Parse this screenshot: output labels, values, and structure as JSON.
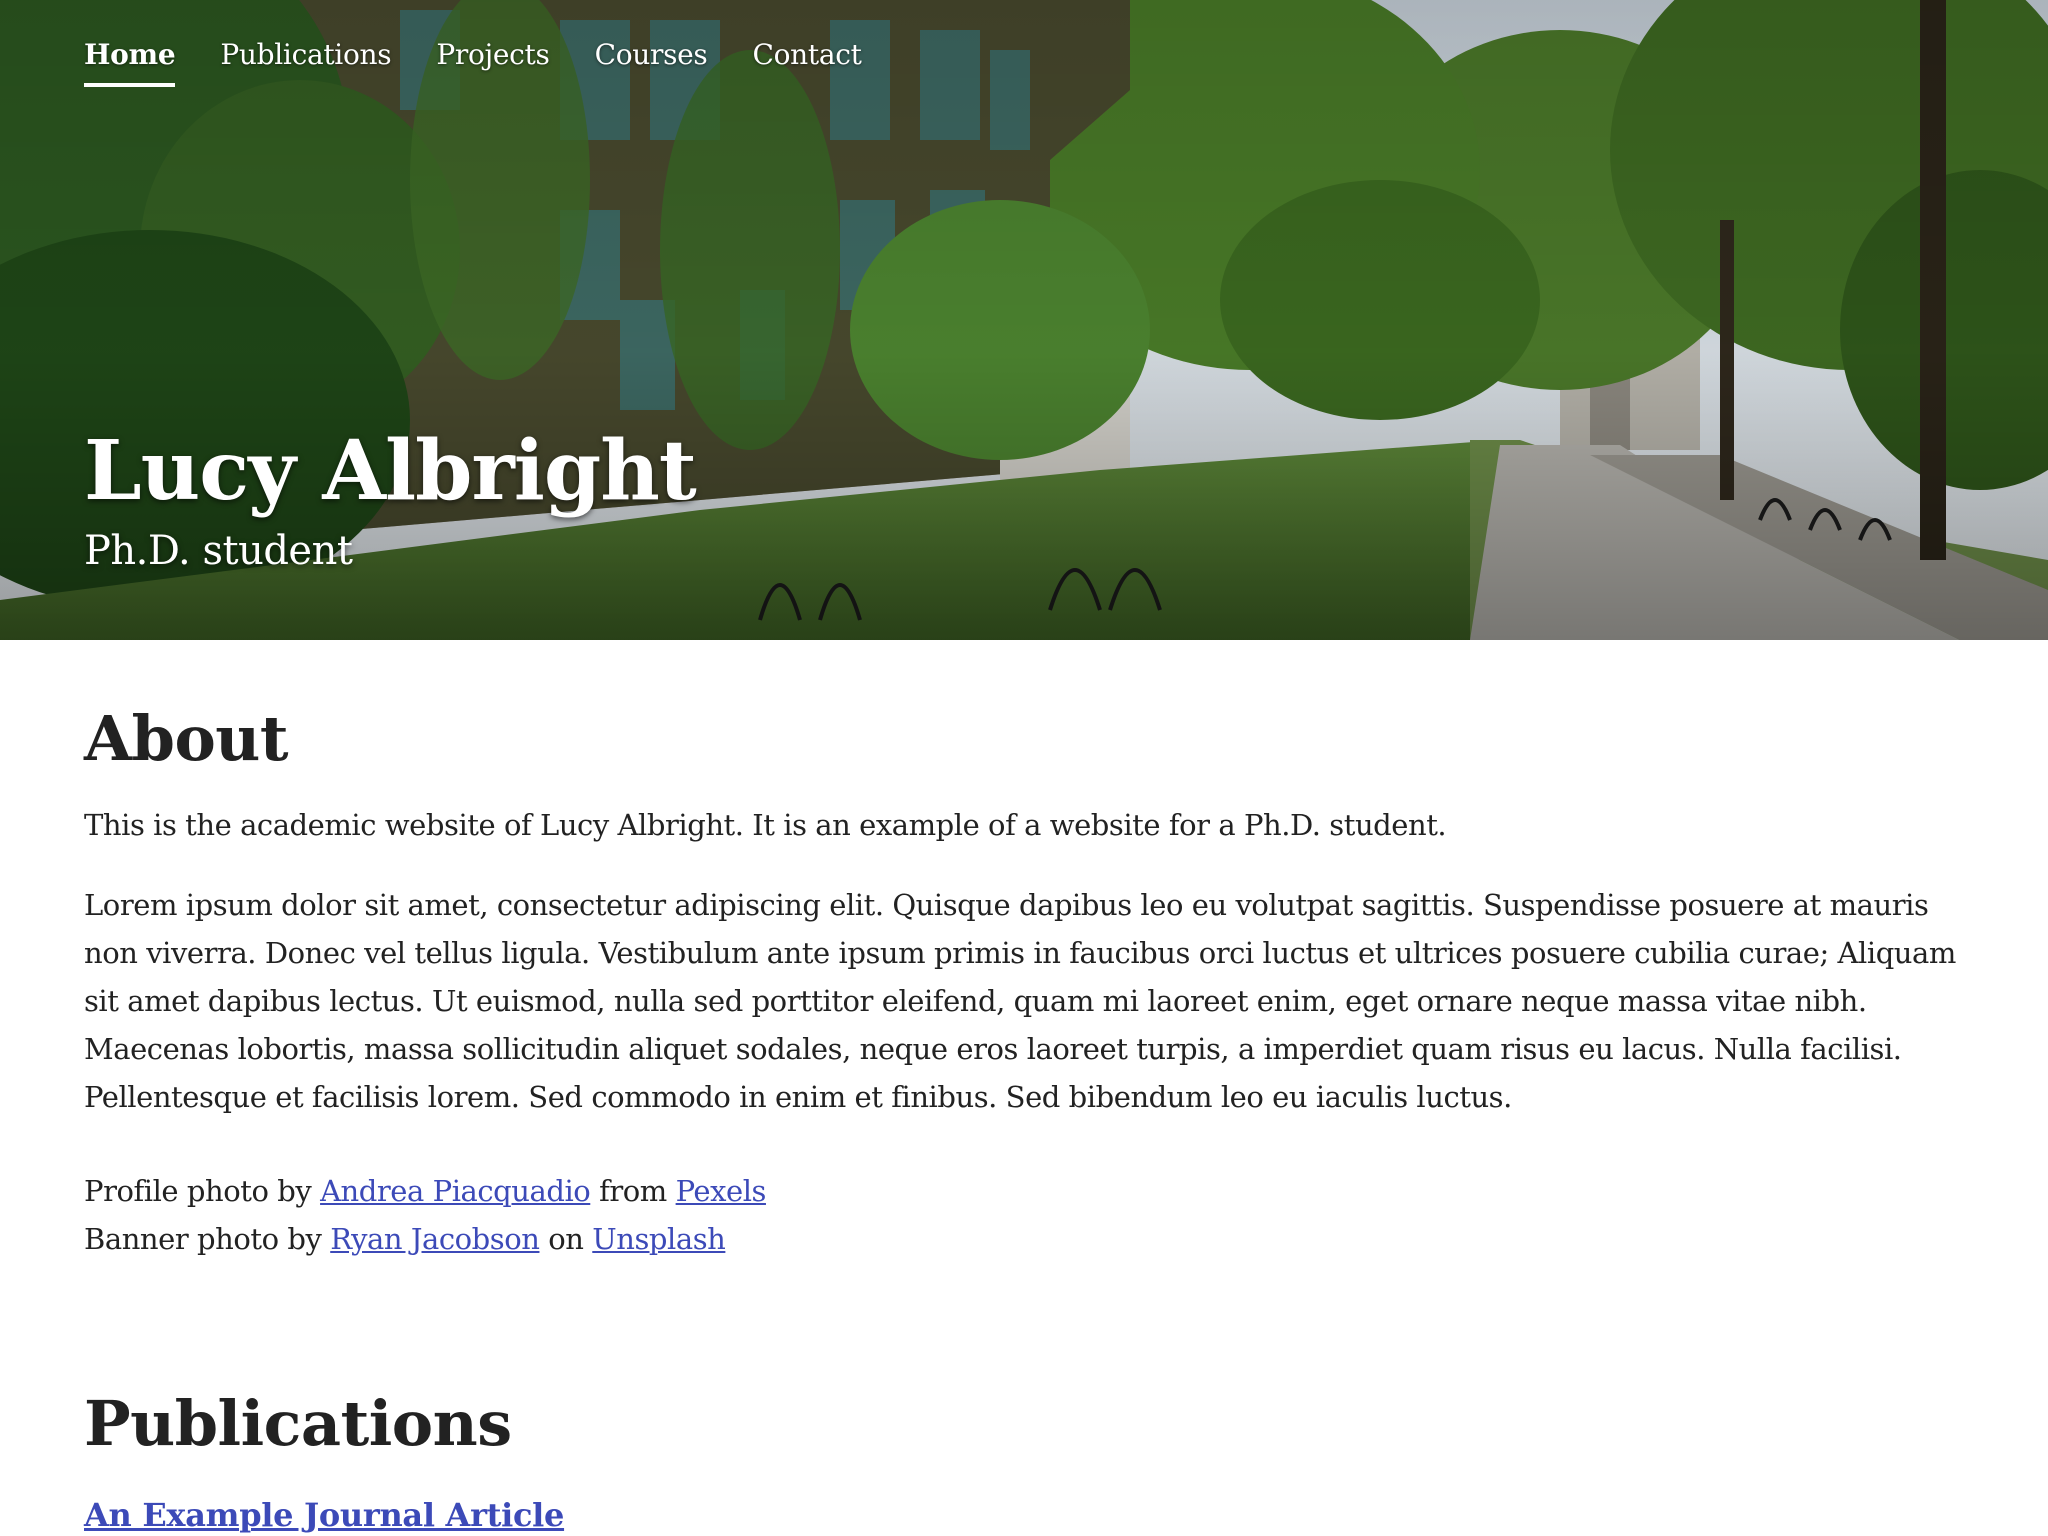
{
  "nav": {
    "items": [
      {
        "label": "Home",
        "active": true
      },
      {
        "label": "Publications"
      },
      {
        "label": "Projects"
      },
      {
        "label": "Courses"
      },
      {
        "label": "Contact"
      }
    ]
  },
  "hero": {
    "name": "Lucy Albright",
    "subtitle": "Ph.D. student"
  },
  "about": {
    "heading": "About",
    "intro": "This is the academic website of Lucy Albright. It is an example of a website for a Ph.D. student.",
    "body": "Lorem ipsum dolor sit amet, consectetur adipiscing elit. Quisque dapibus leo eu volutpat sagittis. Suspendisse posuere at mauris non viverra. Donec vel tellus ligula. Vestibulum ante ipsum primis in faucibus orci luctus et ultrices posuere cubilia curae; Aliquam sit amet dapibus lectus. Ut euismod, nulla sed porttitor eleifend, quam mi laoreet enim, eget ornare neque massa vitae nibh. Maecenas lobortis, massa sollicitudin aliquet sodales, neque eros laoreet turpis, a imperdiet quam risus eu lacus. Nulla facilisi. Pellentesque et facilisis lorem. Sed commodo in enim et finibus. Sed bibendum leo eu iaculis luctus.",
    "credits": {
      "profile_prefix": "Profile photo by",
      "profile_author": "Andrea Piacquadio",
      "profile_mid": "from",
      "profile_source": "Pexels",
      "banner_prefix": "Banner photo by",
      "banner_author": "Ryan Jacobson",
      "banner_mid": "on",
      "banner_source": "Unsplash"
    }
  },
  "publications": {
    "heading": "Publications",
    "items": [
      {
        "title": "An Example Journal Article"
      }
    ]
  },
  "colors": {
    "text": "#222222",
    "link": "#3c4ab8",
    "background": "#ffffff"
  }
}
